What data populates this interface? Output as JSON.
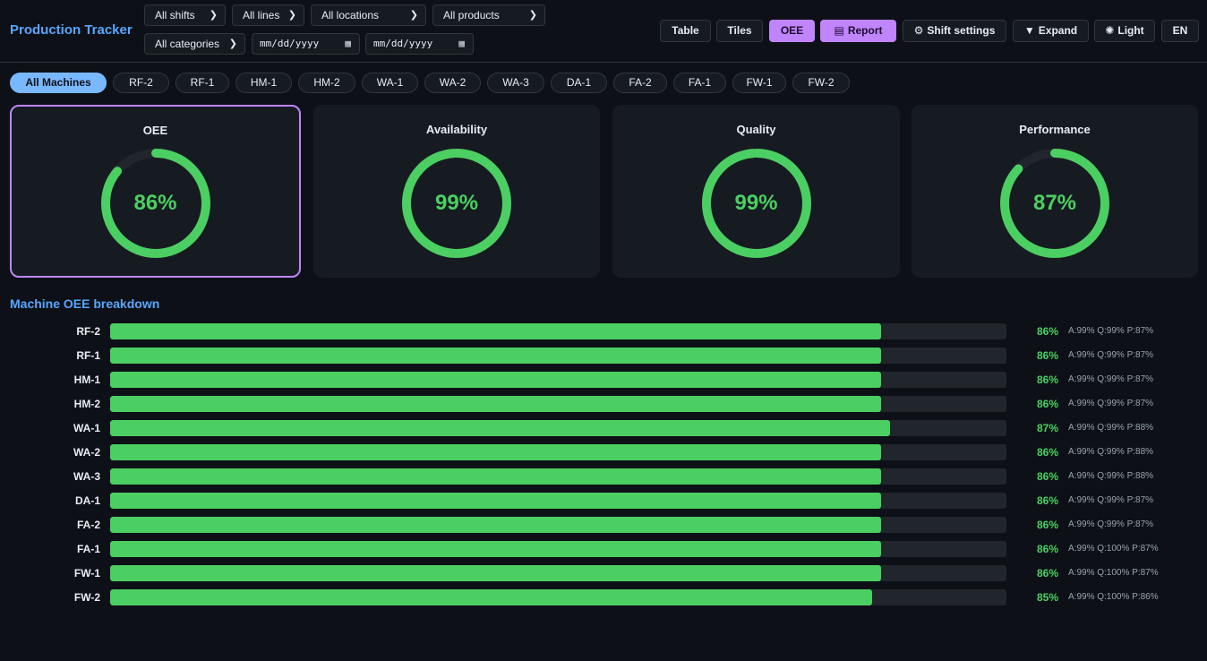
{
  "header": {
    "title": "Production Tracker",
    "filters": {
      "shifts": "All shifts",
      "lines": "All lines",
      "locations": "All locations",
      "products": "All products",
      "categories": "All categories",
      "date_from": "mm/dd/yyyy",
      "date_to": "mm/dd/yyyy"
    },
    "buttons": {
      "table": "Table",
      "tiles": "Tiles",
      "oee": "OEE",
      "report": "Report",
      "shift_settings": "Shift settings",
      "expand": "Expand",
      "light": "Light",
      "lang": "EN"
    }
  },
  "machines_filter": [
    "All Machines",
    "RF-2",
    "RF-1",
    "HM-1",
    "HM-2",
    "WA-1",
    "WA-2",
    "WA-3",
    "DA-1",
    "FA-2",
    "FA-1",
    "FW-1",
    "FW-2"
  ],
  "active_machine": "All Machines",
  "kpis": [
    {
      "label": "OEE",
      "value": "86%",
      "fraction": 0.86
    },
    {
      "label": "Availability",
      "value": "99%",
      "fraction": 0.99
    },
    {
      "label": "Quality",
      "value": "99%",
      "fraction": 0.99
    },
    {
      "label": "Performance",
      "value": "87%",
      "fraction": 0.87
    }
  ],
  "breakdown": {
    "title": "Machine OEE breakdown",
    "rows": [
      {
        "machine": "RF-2",
        "oee": "86%",
        "fraction": 0.86,
        "detail": "A:99% Q:99% P:87%"
      },
      {
        "machine": "RF-1",
        "oee": "86%",
        "fraction": 0.86,
        "detail": "A:99% Q:99% P:87%"
      },
      {
        "machine": "HM-1",
        "oee": "86%",
        "fraction": 0.86,
        "detail": "A:99% Q:99% P:87%"
      },
      {
        "machine": "HM-2",
        "oee": "86%",
        "fraction": 0.86,
        "detail": "A:99% Q:99% P:87%"
      },
      {
        "machine": "WA-1",
        "oee": "87%",
        "fraction": 0.87,
        "detail": "A:99% Q:99% P:88%"
      },
      {
        "machine": "WA-2",
        "oee": "86%",
        "fraction": 0.86,
        "detail": "A:99% Q:99% P:88%"
      },
      {
        "machine": "WA-3",
        "oee": "86%",
        "fraction": 0.86,
        "detail": "A:99% Q:99% P:88%"
      },
      {
        "machine": "DA-1",
        "oee": "86%",
        "fraction": 0.86,
        "detail": "A:99% Q:99% P:87%"
      },
      {
        "machine": "FA-2",
        "oee": "86%",
        "fraction": 0.86,
        "detail": "A:99% Q:99% P:87%"
      },
      {
        "machine": "FA-1",
        "oee": "86%",
        "fraction": 0.86,
        "detail": "A:99% Q:100% P:87%"
      },
      {
        "machine": "FW-1",
        "oee": "86%",
        "fraction": 0.86,
        "detail": "A:99% Q:100% P:87%"
      },
      {
        "machine": "FW-2",
        "oee": "85%",
        "fraction": 0.85,
        "detail": "A:99% Q:100% P:86%"
      }
    ]
  },
  "colors": {
    "accent": "#58a6ff",
    "active_purple": "#c084fc",
    "gauge_green": "#4ccf62",
    "gauge_track": "#21262d"
  }
}
